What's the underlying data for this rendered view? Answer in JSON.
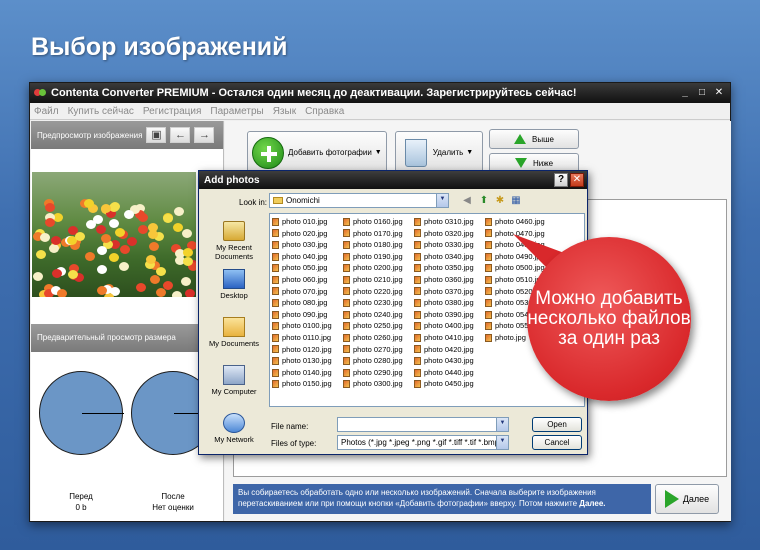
{
  "headline": "Выбор изображений",
  "app": {
    "title": "Contenta Converter PREMIUM  - Остался один месяц до деактивации. Зарегистрируйтесь сейчас!",
    "window_controls": [
      "_",
      "□",
      "✕"
    ],
    "menu": [
      "Файл",
      "Купить сейчас",
      "Регистрация",
      "Параметры",
      "Язык",
      "Справка"
    ]
  },
  "left": {
    "preview_title": "Предпросмотр изображения",
    "size_title": "Предварительный просмотр размера",
    "before_label": "Перед",
    "before_value": "0 b",
    "after_label": "После",
    "after_value": "Нет оценки"
  },
  "toolbar": {
    "add_label": "Добавить фотографии",
    "delete_label": "Удалить",
    "up_label": "Выше",
    "down_label": "Ниже",
    "next_label": "Далее"
  },
  "hint": {
    "text": "Вы собираетесь обработать одно или несколько изображений. Сначала выберите изображения перетаскиванием или при помощи кнопки «Добавить фотографии» вверху. Потом нажмите",
    "bold": "Далее."
  },
  "dialog": {
    "title": "Add photos",
    "look_in_label": "Look in:",
    "look_in_value": "Onomichi",
    "places": [
      "My Recent Documents",
      "Desktop",
      "My Documents",
      "My Computer",
      "My Network"
    ],
    "file_name_label": "File name:",
    "file_name_value": "",
    "file_type_label": "Files of type:",
    "file_type_value": "Photos (*.jpg *.jpeg *.png *.gif *.tiff *.tif *.bmp *.p",
    "open_label": "Open",
    "cancel_label": "Cancel",
    "files": [
      [
        "photo 010.jpg",
        "photo 020.jpg",
        "photo 030.jpg",
        "photo 040.jpg",
        "photo 050.jpg",
        "photo 060.jpg",
        "photo 070.jpg",
        "photo 080.jpg",
        "photo 090.jpg",
        "photo 0100.jpg",
        "photo 0110.jpg",
        "photo 0120.jpg",
        "photo 0130.jpg",
        "photo 0140.jpg",
        "photo 0150.jpg"
      ],
      [
        "photo 0160.jpg",
        "photo 0170.jpg",
        "photo 0180.jpg",
        "photo 0190.jpg",
        "photo 0200.jpg",
        "photo 0210.jpg",
        "photo 0220.jpg",
        "photo 0230.jpg",
        "photo 0240.jpg",
        "photo 0250.jpg",
        "photo 0260.jpg",
        "photo 0270.jpg",
        "photo 0280.jpg",
        "photo 0290.jpg",
        "photo 0300.jpg"
      ],
      [
        "photo 0310.jpg",
        "photo 0320.jpg",
        "photo 0330.jpg",
        "photo 0340.jpg",
        "photo 0350.jpg",
        "photo 0360.jpg",
        "photo 0370.jpg",
        "photo 0380.jpg",
        "photo 0390.jpg",
        "photo 0400.jpg",
        "photo 0410.jpg",
        "photo 0420.jpg",
        "photo 0430.jpg",
        "photo 0440.jpg",
        "photo 0450.jpg"
      ],
      [
        "photo 0460.jpg",
        "photo 0470.jpg",
        "photo 0480.jpg",
        "photo 0490.jpg",
        "photo 0500.jpg",
        "photo 0510.jpg",
        "photo 0520.jpg",
        "photo 0530.jpg",
        "photo 0540.jpg",
        "photo 0550.jpg",
        "photo.jpg"
      ]
    ]
  },
  "callout": "Можно добавить несколько файлов за один раз"
}
